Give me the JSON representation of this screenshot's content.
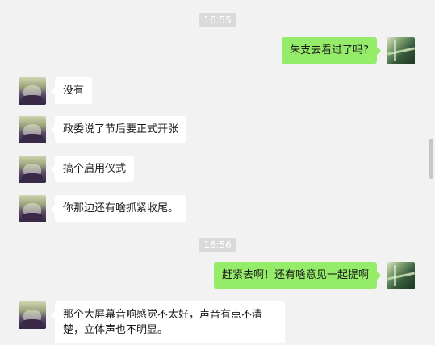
{
  "timestamps": [
    "16:55",
    "16:56"
  ],
  "messages": [
    {
      "from": "me",
      "text": "朱支去看过了吗?"
    },
    {
      "from": "friend",
      "text": "没有"
    },
    {
      "from": "friend",
      "text": "政委说了节后要正式开张"
    },
    {
      "from": "friend",
      "text": "搞个启用仪式"
    },
    {
      "from": "friend",
      "text": "你那边还有啥抓紧收尾。"
    },
    {
      "from": "me",
      "text": "赶紧去啊！还有啥意见一起提啊"
    },
    {
      "from": "friend",
      "text": "那个大屏幕音响感觉不太好，声音有点不清楚，立体声也不明显。"
    }
  ],
  "colors": {
    "background": "#f2f2f2",
    "sent_bubble": "#95ec69",
    "received_bubble": "#ffffff",
    "timestamp_bg": "#dadada"
  }
}
